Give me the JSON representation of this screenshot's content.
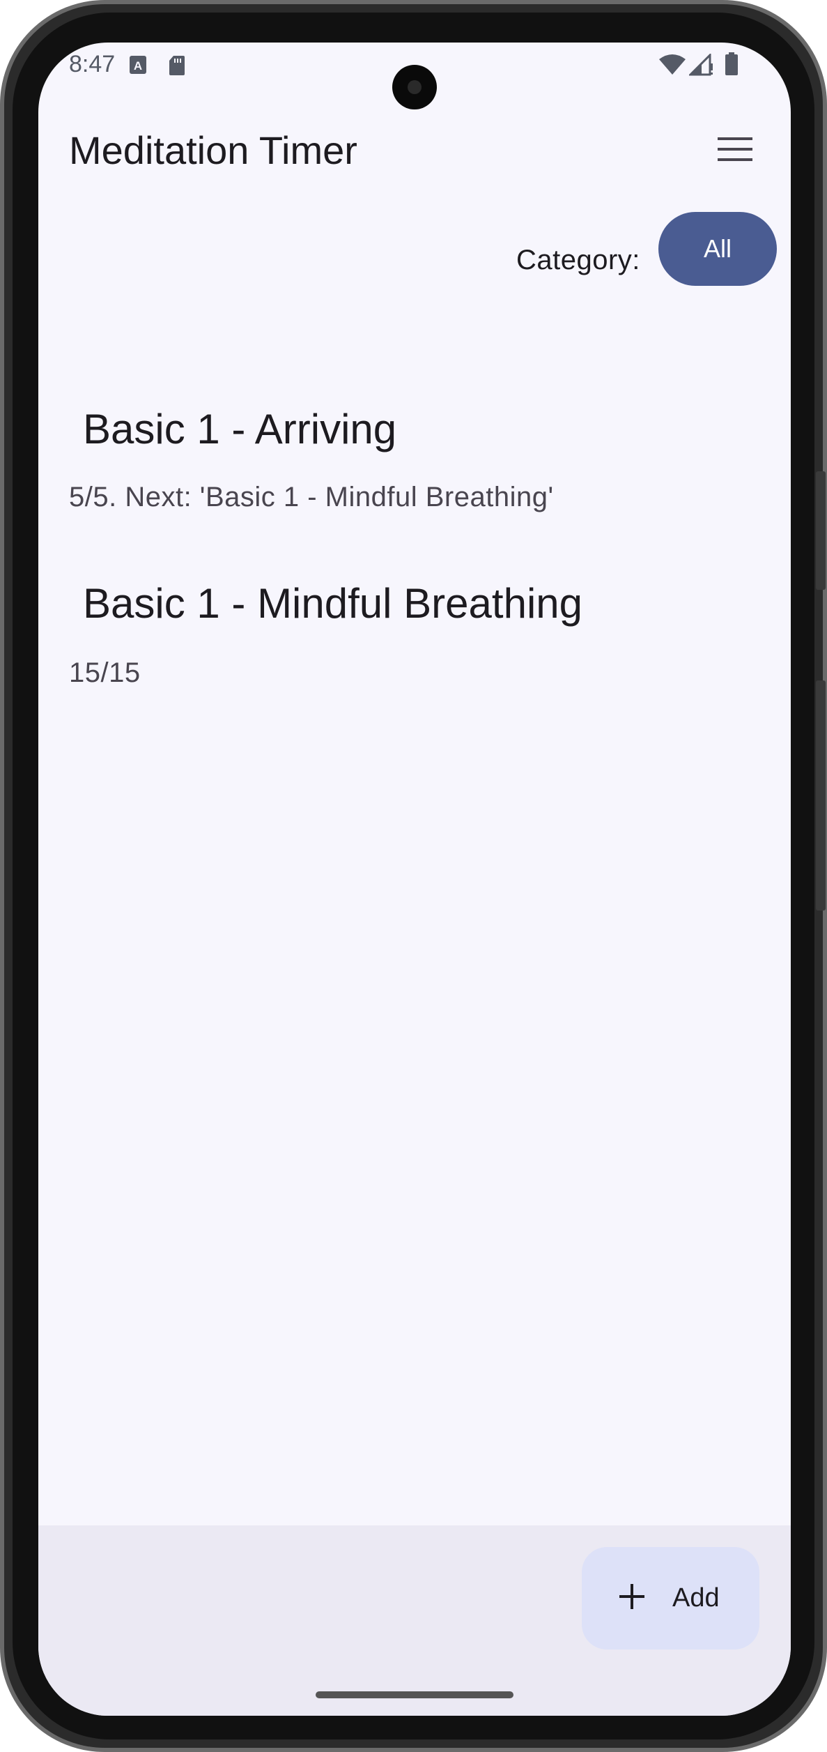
{
  "status_bar": {
    "time": "8:47",
    "icons": [
      "a-box-icon",
      "sd-card-icon",
      "wifi-icon",
      "signal-icon",
      "battery-icon"
    ]
  },
  "app_bar": {
    "title": "Meditation Timer",
    "menu_icon": "hamburger-menu-icon"
  },
  "filter": {
    "label": "Category:",
    "selected": "All"
  },
  "items": [
    {
      "title": "Basic 1 - Arriving",
      "subtitle": "5/5. Next: 'Basic 1 - Mindful Breathing'"
    },
    {
      "title": "Basic 1 - Mindful Breathing",
      "subtitle": "15/15"
    }
  ],
  "fab": {
    "icon": "plus-icon",
    "label": "Add"
  },
  "colors": {
    "background": "#f7f6fd",
    "chip": "#4a5c92",
    "fab": "#dde1f8",
    "bottom_bar": "#ebe9f3"
  }
}
